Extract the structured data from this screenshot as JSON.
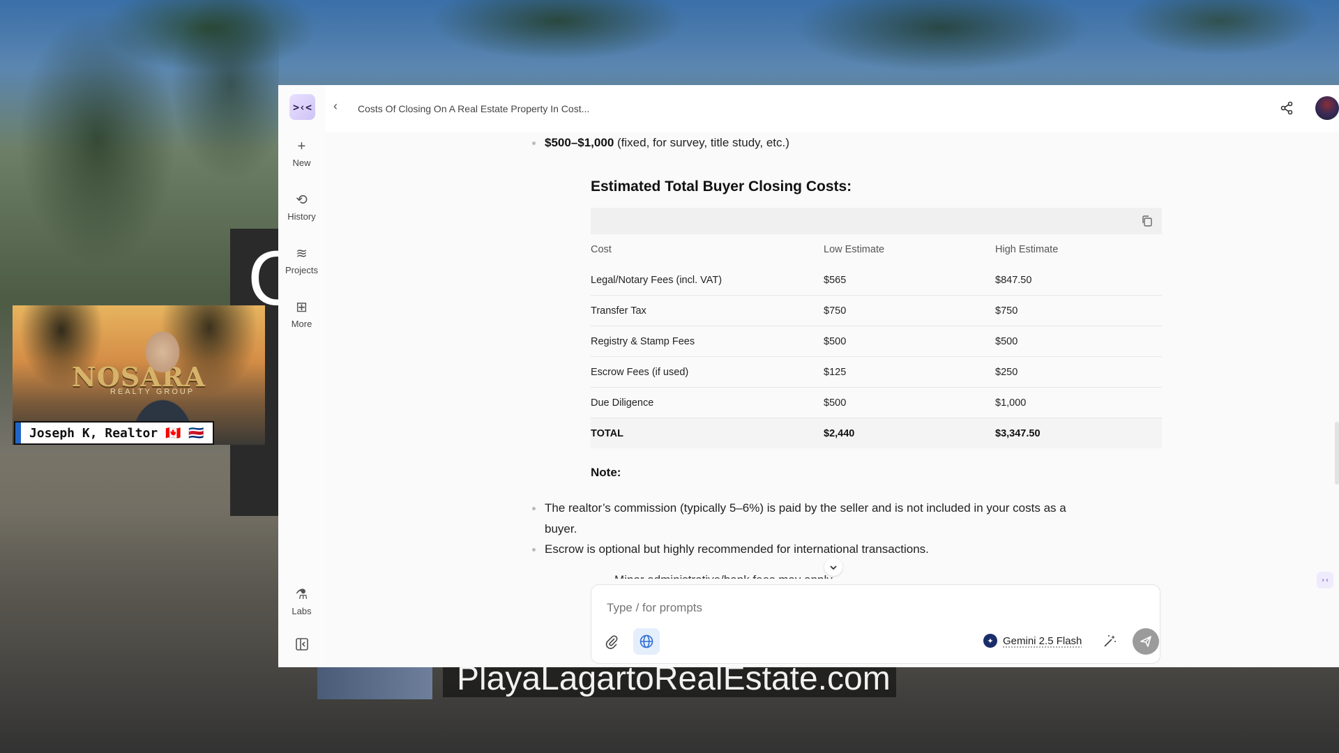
{
  "background": {
    "banner_text": "PlayaLagartoRealEstate.com",
    "big_letter": "C"
  },
  "video_overlay": {
    "logo_text": "NOSARA",
    "logo_sub": "REALTY GROUP",
    "caption": "Joseph K, Realtor 🇨🇦 🇨🇷"
  },
  "sidebar": {
    "logo_glyph": ">‹<",
    "items": [
      {
        "label": "New",
        "icon": "plus-icon",
        "glyph": "+"
      },
      {
        "label": "History",
        "icon": "history-icon",
        "glyph": "⟲"
      },
      {
        "label": "Projects",
        "icon": "layers-icon",
        "glyph": "≋"
      },
      {
        "label": "More",
        "icon": "apps-icon",
        "glyph": "⊞"
      },
      {
        "label": "Labs",
        "icon": "flask-icon",
        "glyph": "⚗"
      }
    ],
    "collapse_icon": "panel-toggle-icon"
  },
  "header": {
    "back_icon": "chevron-left-icon",
    "title": "Costs Of Closing On A Real Estate Property In Cost...",
    "share_icon": "share-icon",
    "avatar_icon": "user-avatar"
  },
  "content": {
    "prev_bullet": {
      "bold": "$500–$1,000",
      "rest": " (fixed, for survey, title study, etc.)"
    },
    "heading": "Estimated Total Buyer Closing Costs:",
    "table": {
      "headers": [
        "Cost",
        "Low Estimate",
        "High Estimate"
      ],
      "rows": [
        [
          "Legal/Notary Fees (incl. VAT)",
          "$565",
          "$847.50"
        ],
        [
          "Transfer Tax",
          "$750",
          "$750"
        ],
        [
          "Registry & Stamp Fees",
          "$500",
          "$500"
        ],
        [
          "Escrow Fees (if used)",
          "$125",
          "$250"
        ],
        [
          "Due Diligence",
          "$500",
          "$1,000"
        ]
      ],
      "total": [
        "TOTAL",
        "$2,440",
        "$3,347.50"
      ]
    },
    "note_heading": "Note:",
    "notes": [
      "The realtor’s commission (typically 5–6%) is paid by the seller and is not included in your costs as a buyer.",
      "Escrow is optional but highly recommended for international transactions."
    ],
    "note_partial": "Minor administrative/bank fees may apply."
  },
  "composer": {
    "placeholder": "Type / for prompts",
    "model": "Gemini 2.5 Flash"
  },
  "colors": {
    "accent": "#5b4bd6",
    "send": "#9b9b9b",
    "web_search_bg": "#e5eefb"
  }
}
